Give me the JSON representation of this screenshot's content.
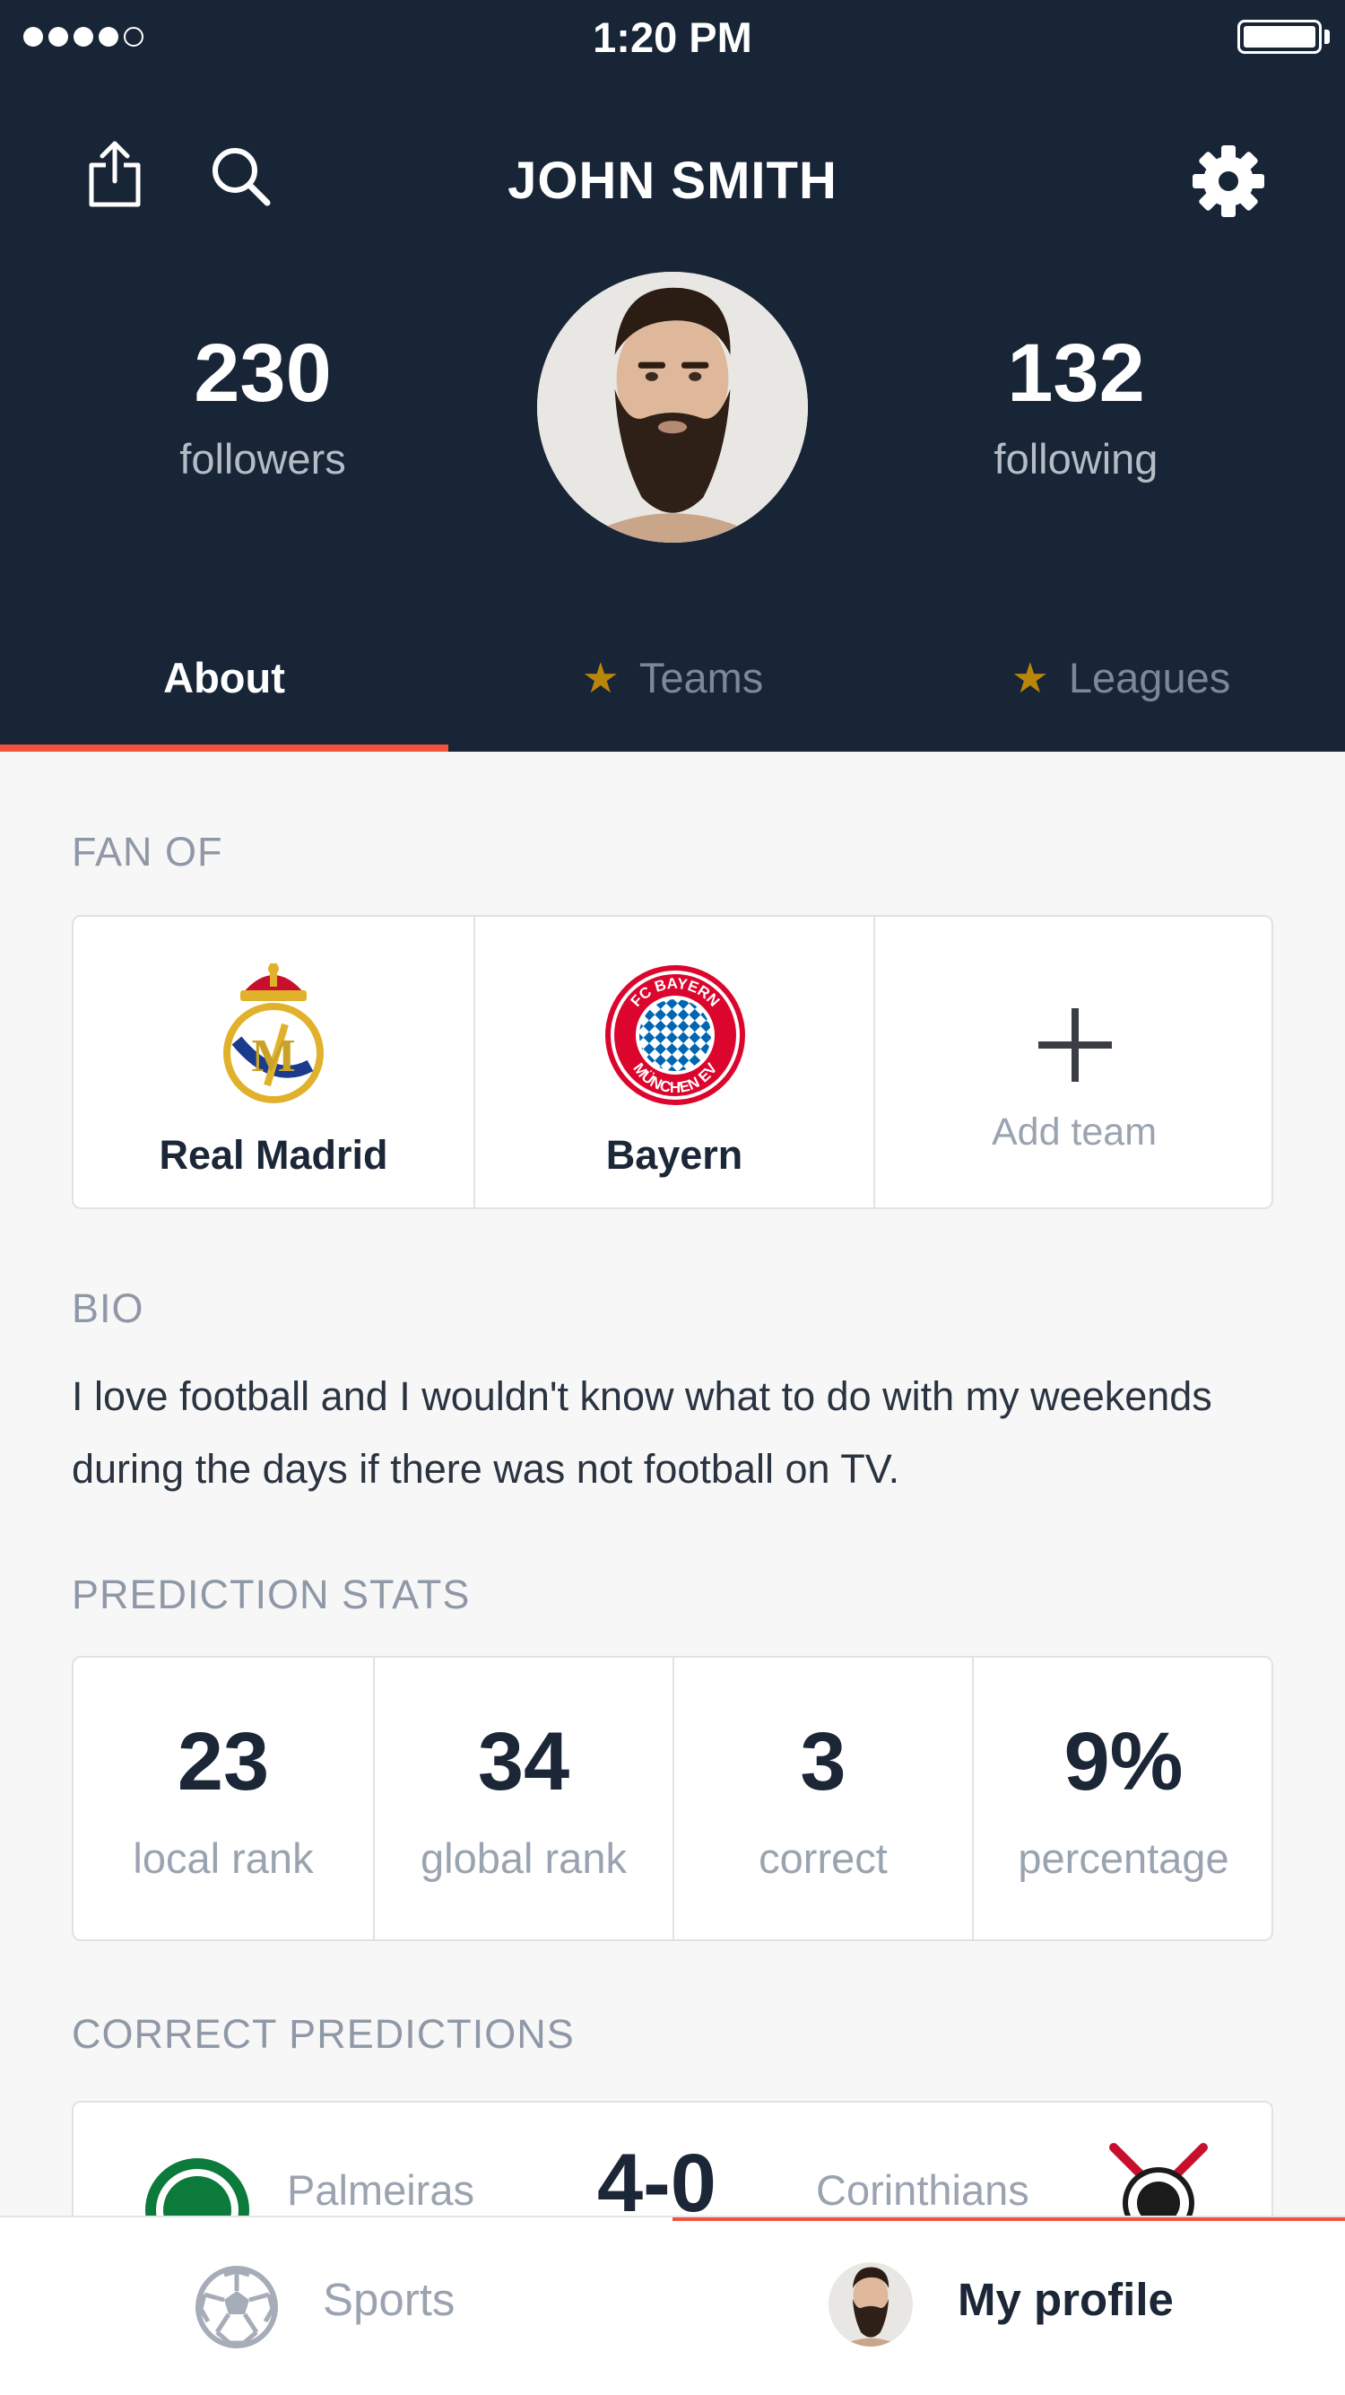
{
  "status_bar": {
    "time": "1:20 PM"
  },
  "header": {
    "title": "JOHN SMITH",
    "followers": {
      "count": "230",
      "label": "followers"
    },
    "following": {
      "count": "132",
      "label": "following"
    }
  },
  "tabs": [
    {
      "label": "About",
      "active": true
    },
    {
      "label": "Teams",
      "active": false
    },
    {
      "label": "Leagues",
      "active": false
    }
  ],
  "fan_of": {
    "section_label": "FAN OF",
    "teams": [
      {
        "name": "Real Madrid"
      },
      {
        "name": "Bayern"
      }
    ],
    "add_label": "Add team"
  },
  "bio": {
    "section_label": "BIO",
    "text": "I love football and I wouldn't know what to do with my weekends during the days if there was not football on TV."
  },
  "prediction_stats": {
    "section_label": "PREDICTION STATS",
    "stats": [
      {
        "value": "23",
        "label": "local rank"
      },
      {
        "value": "34",
        "label": "global rank"
      },
      {
        "value": "3",
        "label": "correct"
      },
      {
        "value": "9%",
        "label": "percentage"
      }
    ]
  },
  "correct_predictions": {
    "section_label": "CORRECT PREDICTIONS",
    "matches": [
      {
        "home": "Palmeiras",
        "score": "4-0",
        "away": "Corinthians"
      }
    ]
  },
  "bottom_nav": {
    "items": [
      {
        "label": "Sports",
        "active": false
      },
      {
        "label": "My profile",
        "active": true
      }
    ]
  },
  "colors": {
    "header_bg": "#172536",
    "accent": "#f2533f",
    "star": "#b8860b",
    "muted_text": "#9aa3b0"
  }
}
